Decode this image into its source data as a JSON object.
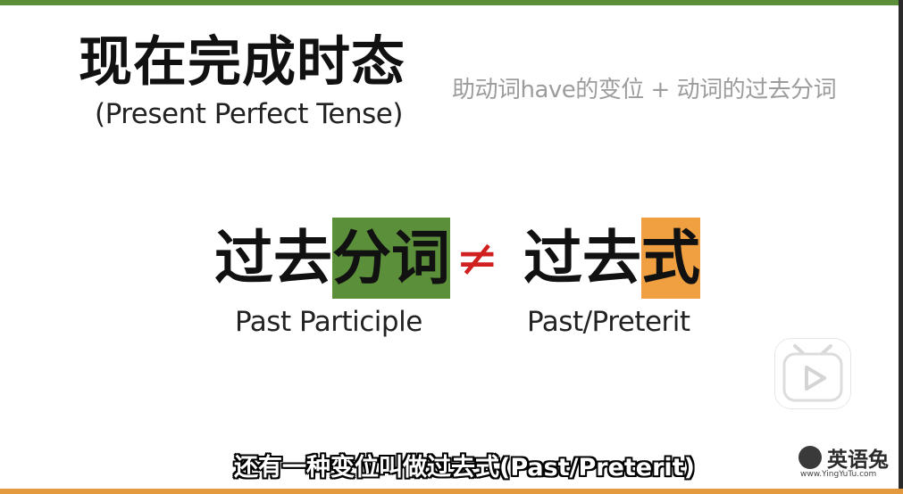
{
  "slide": {
    "title": "现在完成时态",
    "subtitle": "(Present Perfect Tense)",
    "formula": "助动词have的变位 + 动词的过去分词",
    "left_term": {
      "plain": "过去",
      "highlight": "分词",
      "caption": "Past Participle"
    },
    "not_equal": "≠",
    "right_term": {
      "plain": "过去",
      "highlight": "式",
      "caption": "Past/Preterit"
    },
    "colors": {
      "green": "#5b8f3a",
      "orange": "#f0a040",
      "neq_red": "#d12020"
    }
  },
  "player": {
    "play_icon": "play-icon"
  },
  "caption": {
    "text": "还有一种变位叫做过去式(Past/Preterit)"
  },
  "watermark": {
    "name": "英语兔",
    "url": "www.YingYuTu.com"
  }
}
